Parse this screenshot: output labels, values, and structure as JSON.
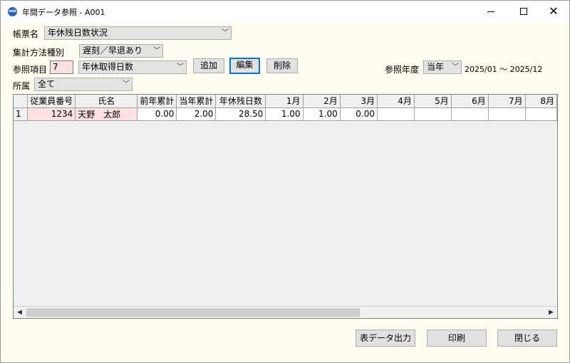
{
  "window": {
    "title": "年間データ参照 - A001",
    "app_icon_text": "oeb"
  },
  "form": {
    "report_label": "帳票名",
    "report_value": "年休残日数状況",
    "method_label": "集計方法種別",
    "method_value": "遅刻／早退あり",
    "item_label": "参照項目",
    "item_number": "7",
    "item_value": "年休取得日数",
    "add_button": "追加",
    "edit_button": "編集",
    "delete_button": "削除",
    "year_label": "参照年度",
    "year_value": "当年",
    "year_range": "2025/01 ～ 2025/12",
    "dept_label": "所属",
    "dept_value": "全て"
  },
  "grid": {
    "columns": [
      "",
      "従業員番号",
      "氏名",
      "前年累計",
      "当年累計",
      "年休残日数",
      "1月",
      "2月",
      "3月",
      "4月",
      "5月",
      "6月",
      "7月",
      "8月"
    ],
    "rows": [
      [
        "1",
        "1234",
        "天野　太郎",
        "0.00",
        "2.00",
        "28.50",
        "1.00",
        "1.00",
        "0.00",
        "",
        "",
        "",
        "",
        ""
      ]
    ]
  },
  "footer": {
    "export_button": "表データ出力",
    "print_button": "印刷",
    "close_button": "閉じる"
  },
  "colors": {
    "window_bg": "#fffdf0",
    "pink_cell": "#ffe0e0",
    "focus_border": "#0078d7"
  }
}
